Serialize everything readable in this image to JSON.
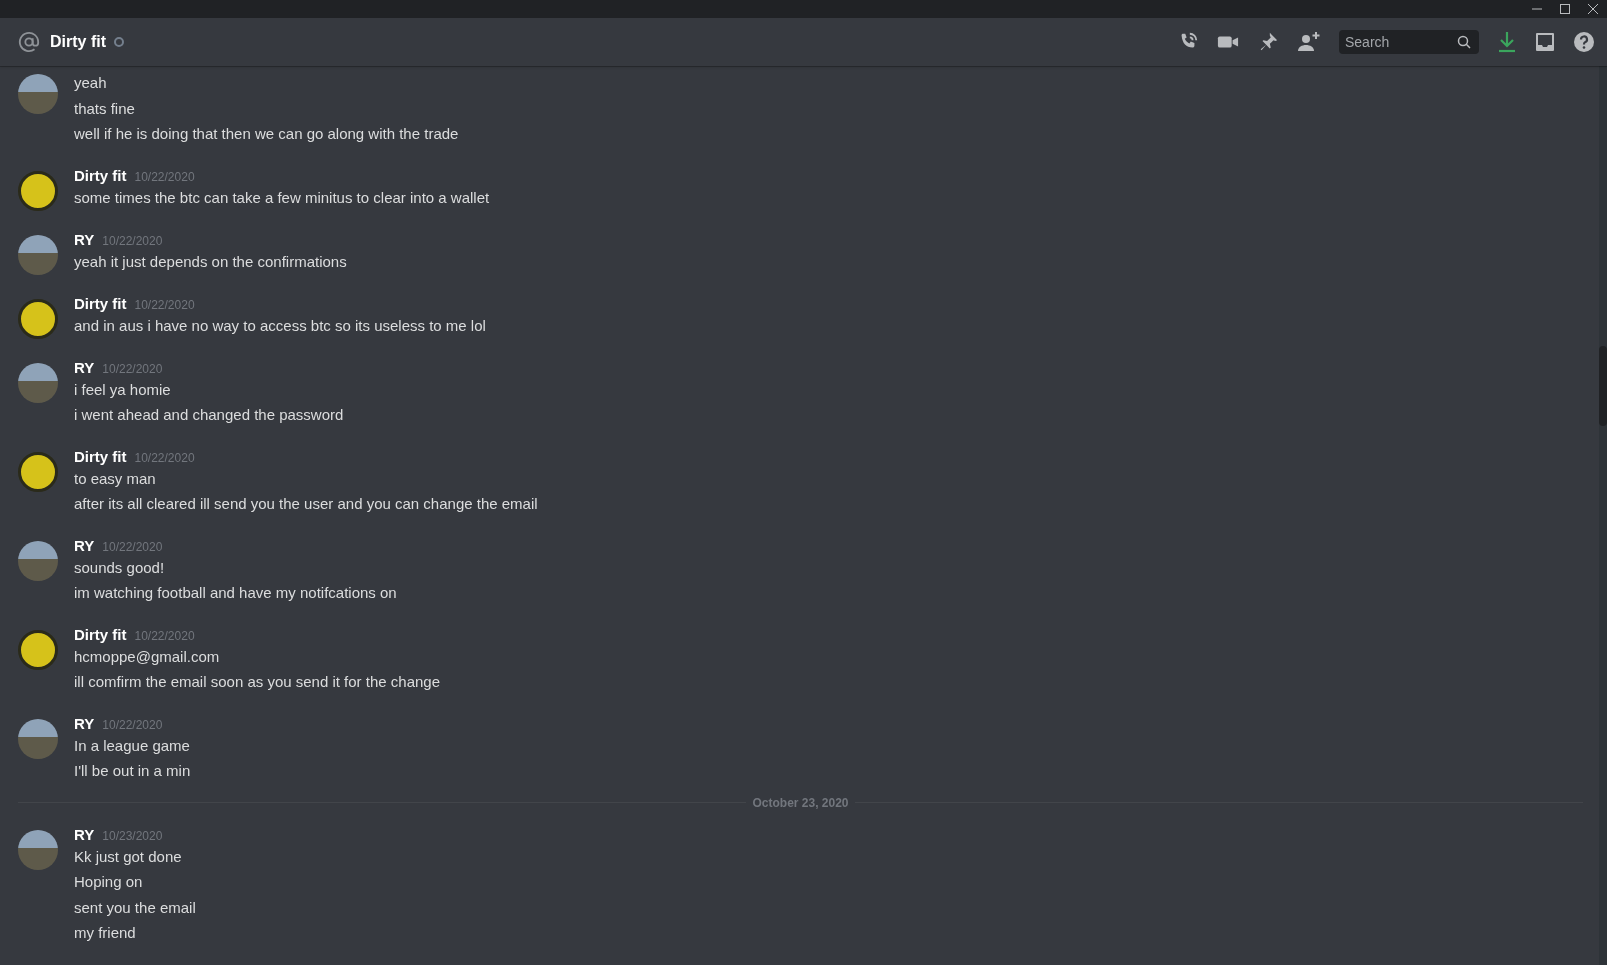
{
  "header": {
    "title": "Dirty fit",
    "online": false,
    "search": {
      "placeholder": "Search"
    }
  },
  "feed": [
    {
      "kind": "group",
      "avatar": {
        "kind": "photo"
      },
      "lines": [
        "yeah",
        "thats fine",
        "well if he is doing that then we can go along with the trade"
      ]
    },
    {
      "kind": "group",
      "avatar": {
        "kind": "logo"
      },
      "author": "Dirty fit",
      "timestamp": "10/22/2020",
      "lines": [
        "some times the btc can take a few minitus to clear into a wallet"
      ]
    },
    {
      "kind": "group",
      "avatar": {
        "kind": "photo"
      },
      "author": "RY",
      "timestamp": "10/22/2020",
      "lines": [
        "yeah it just depends on the confirmations"
      ]
    },
    {
      "kind": "group",
      "avatar": {
        "kind": "logo"
      },
      "author": "Dirty fit",
      "timestamp": "10/22/2020",
      "lines": [
        "and in aus i have no way to access btc so its useless to me lol"
      ]
    },
    {
      "kind": "group",
      "avatar": {
        "kind": "photo"
      },
      "author": "RY",
      "timestamp": "10/22/2020",
      "lines": [
        "i feel ya homie",
        "i went ahead and changed the password"
      ]
    },
    {
      "kind": "group",
      "avatar": {
        "kind": "logo"
      },
      "author": "Dirty fit",
      "timestamp": "10/22/2020",
      "lines": [
        "to easy man",
        "after its all cleared ill send you the user and you can change the email"
      ]
    },
    {
      "kind": "group",
      "avatar": {
        "kind": "photo"
      },
      "author": "RY",
      "timestamp": "10/22/2020",
      "lines": [
        "sounds good!",
        "im watching football and have my notifcations on"
      ]
    },
    {
      "kind": "group",
      "avatar": {
        "kind": "logo"
      },
      "author": "Dirty fit",
      "timestamp": "10/22/2020",
      "lines": [
        "hcmoppe@gmail.com",
        "ill comfirm the email soon as you send it for the change"
      ]
    },
    {
      "kind": "group",
      "avatar": {
        "kind": "photo"
      },
      "author": "RY",
      "timestamp": "10/22/2020",
      "lines": [
        "In a league game",
        "I'll be out in a min"
      ]
    },
    {
      "kind": "divider",
      "label": "October 23, 2020"
    },
    {
      "kind": "group",
      "avatar": {
        "kind": "photo"
      },
      "author": "RY",
      "timestamp": "10/23/2020",
      "lines": [
        "Kk just got done",
        "Hoping on",
        "sent you the email",
        "my friend"
      ]
    }
  ]
}
